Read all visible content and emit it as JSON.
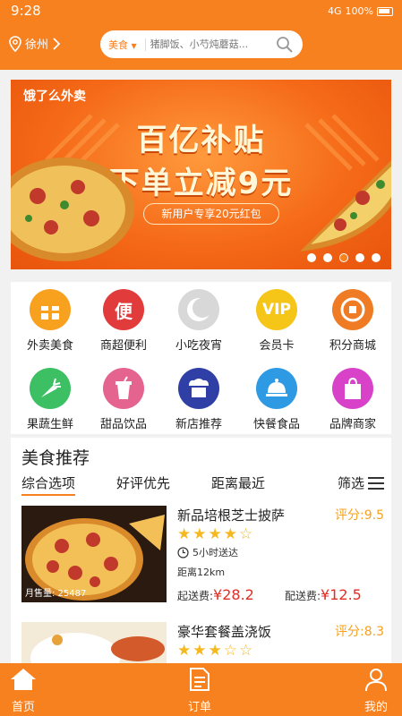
{
  "status": {
    "time": "9:28",
    "network": "4G",
    "battery": "100%"
  },
  "header": {
    "location": "徐州",
    "search_category": "美食",
    "search_placeholder": "猪脚饭、小芍炖蘑菇..."
  },
  "banner": {
    "logo": "饿了么外卖",
    "title": "百亿补贴",
    "subtitle": "下单立减9元",
    "tag": "新用户专享20元红包",
    "dots": 5,
    "active_dot": 3
  },
  "categories": [
    {
      "label": "外卖美食",
      "icon": "gift-icon",
      "color": "#f7a11f",
      "glyph": "▦"
    },
    {
      "label": "商超便利",
      "icon": "convenience-icon",
      "color": "#e23b3b",
      "glyph": "便"
    },
    {
      "label": "小吃夜宵",
      "icon": "moon-icon",
      "color": "#d0d0d0",
      "glyph": "☾"
    },
    {
      "label": "会员卡",
      "icon": "vip-icon",
      "color": "#f5c518",
      "glyph": "VIP"
    },
    {
      "label": "积分商城",
      "icon": "points-icon",
      "color": "#ef7c24",
      "glyph": "◉"
    },
    {
      "label": "果蔬生鲜",
      "icon": "carrot-icon",
      "color": "#3cc063",
      "glyph": "♣"
    },
    {
      "label": "甜品饮品",
      "icon": "drink-icon",
      "color": "#e5638f",
      "glyph": "♨"
    },
    {
      "label": "新店推荐",
      "icon": "shop-icon",
      "color": "#2f3fa6",
      "glyph": "⌂"
    },
    {
      "label": "快餐食品",
      "icon": "dish-icon",
      "color": "#2e9ae4",
      "glyph": "⌓"
    },
    {
      "label": "品牌商家",
      "icon": "bag-icon",
      "color": "#d742c8",
      "glyph": "◫"
    }
  ],
  "recommend": {
    "title": "美食推荐",
    "tabs": [
      "综合选项",
      "好评优先",
      "距离最近"
    ],
    "filter": "筛选",
    "items": [
      {
        "name": "新品培根芝士披萨",
        "score": "评分:9.5",
        "stars": 4,
        "delivery_time": "5小时送达",
        "distance": "距离12km",
        "start_fee_label": "起送费:",
        "start_fee": "¥28.2",
        "delivery_fee_label": "配送费:",
        "delivery_fee": "¥12.5",
        "sales": "月售量: 25487"
      },
      {
        "name": "豪华套餐盖浇饭",
        "score": "评分:8.3",
        "stars": 3
      }
    ]
  },
  "bottom_nav": [
    {
      "label": "首页",
      "icon": "home-icon"
    },
    {
      "label": "订单",
      "icon": "order-icon"
    },
    {
      "label": "我的",
      "icon": "user-icon"
    }
  ],
  "colors": {
    "brand": "#f7801f",
    "price": "#e02e24",
    "star": "#f5b81e"
  }
}
